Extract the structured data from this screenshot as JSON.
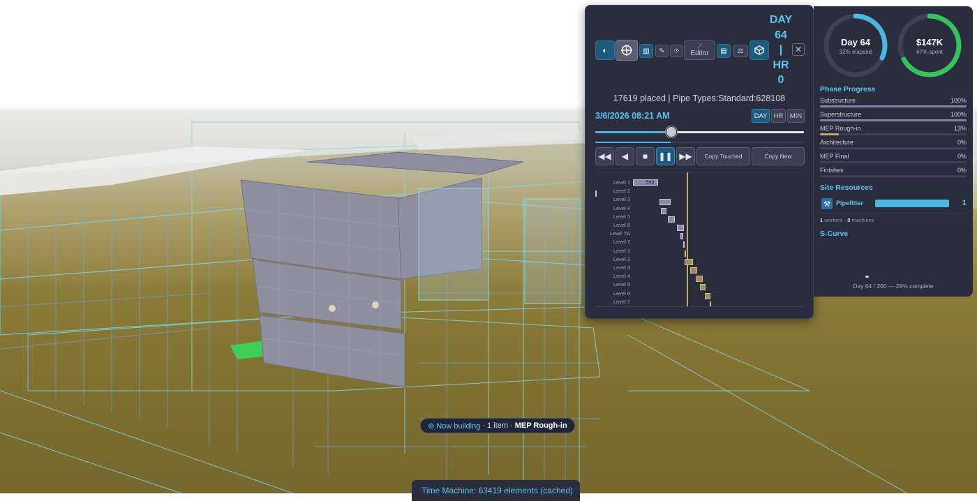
{
  "toolbar": {
    "editor_label": "Editor",
    "icons": [
      "contrast-icon",
      "crosshair-icon",
      "chart-icon",
      "pencil-icon",
      "navigate-icon",
      "clipboard-icon",
      "scale-icon",
      "cube-icon",
      "close-icon"
    ],
    "day_hr_label": "DAY\n64\n|\nHR\n0"
  },
  "status_line": "17619 placed | Pipe Types:Standard:628108",
  "datetime": "3/6/2026 08:21 AM",
  "time_units": {
    "day": "DAY",
    "hr": "HR",
    "min": "MIN",
    "active": "DAY"
  },
  "timeline_progress": 0.36,
  "playback": {
    "rewind": "◀◀",
    "step_back": "◀",
    "stop": "■",
    "pause": "❚❚",
    "fast_forward": "▶▶",
    "copy_touched": "Copy Touched",
    "copy_new": "Copy New"
  },
  "gantt": {
    "rows": [
      "Level 1",
      "Level 2",
      "Level 3",
      "Level 4",
      "Level 5",
      "Level 6",
      "Level 7A",
      "Level 7",
      "Level 1",
      "Level 2",
      "Level 3",
      "Level 4",
      "Level 5",
      "Level 6",
      "Level 7"
    ],
    "first_bar_label": "Sub"
  },
  "summary": {
    "day_ring": {
      "title": "Day 64",
      "subtitle": "32% elapsed",
      "fraction": 0.32,
      "color": "#4ab7e0"
    },
    "cost_ring": {
      "title": "$147K",
      "subtitle": "67% spent",
      "fraction": 0.67,
      "color": "#36c45a"
    }
  },
  "phase_progress": {
    "title": "Phase Progress",
    "phases": [
      {
        "name": "Substructure",
        "pct": "100%",
        "value": 1.0,
        "color": "#7f86a8"
      },
      {
        "name": "Superstructure",
        "pct": "100%",
        "value": 1.0,
        "color": "#7f86a8"
      },
      {
        "name": "MEP Rough-in",
        "pct": "13%",
        "value": 0.13,
        "color": "#c4a866"
      },
      {
        "name": "Architecture",
        "pct": "0%",
        "value": 0,
        "color": "#7f86a8"
      },
      {
        "name": "MEP Final",
        "pct": "0%",
        "value": 0,
        "color": "#7f86a8"
      },
      {
        "name": "Finishes",
        "pct": "0%",
        "value": 0,
        "color": "#7f86a8"
      }
    ]
  },
  "site_resources": {
    "title": "Site Resources",
    "resource_name": "Pipefitter",
    "resource_count": "1",
    "workers": "1",
    "workers_label": "workers ·",
    "machines": "0",
    "machines_label": "machines"
  },
  "s_curve": {
    "title": "S-Curve",
    "footer": "Day 64 / 200 — 28% complete"
  },
  "now_building": {
    "prefix": "⊕ Now building",
    "middle": "· 1 item ·",
    "phase": "MEP Rough-in"
  },
  "time_machine_status": "Time Machine: 63419 elements (cached)"
}
